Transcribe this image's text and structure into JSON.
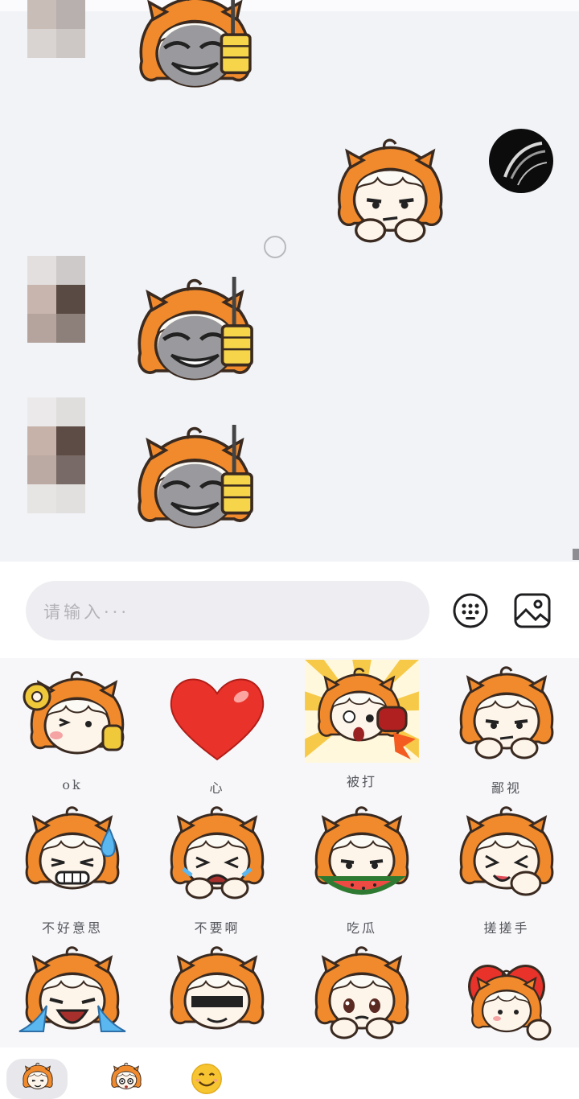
{
  "input": {
    "placeholder": "请输入···"
  },
  "stickers": [
    {
      "label": "ok"
    },
    {
      "label": "心"
    },
    {
      "label": "被打"
    },
    {
      "label": "鄙视"
    },
    {
      "label": "不好意思"
    },
    {
      "label": "不要啊"
    },
    {
      "label": "吃瓜"
    },
    {
      "label": "搓搓手"
    },
    {
      "label": ""
    },
    {
      "label": ""
    },
    {
      "label": ""
    },
    {
      "label": ""
    }
  ],
  "colors": {
    "chat_bg": "#f1f3f7",
    "hair_orange": "#f08a2c",
    "heart_red": "#e8322a",
    "input_bg": "#eeeef2"
  },
  "icons": {
    "keypad": "keypad-icon",
    "image": "image-icon",
    "tab1": "sticker-pack-icon",
    "tab2": "sticker-pack-2-icon",
    "tab3": "smiley-emoji-icon"
  }
}
